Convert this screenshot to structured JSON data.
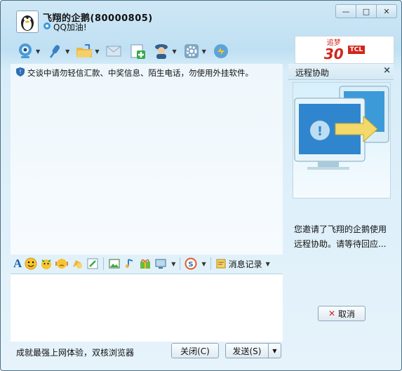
{
  "title": {
    "name": "飞翔的企鹅(80000805)",
    "status": "QQ加油!"
  },
  "window_buttons": {
    "minimize": "—",
    "maximize": "□",
    "close": "✕"
  },
  "ad": {
    "top": "追梦",
    "big": "30",
    "brand": "TCL"
  },
  "notice": "交谈中请勿轻信汇款、中奖信息、陌生电话，勿使用外挂软件。",
  "format_bar": {
    "history_label": "消息记录"
  },
  "bottom": {
    "slogan": "成就最强上网体验，双核浏览器",
    "close_label": "关闭(C)",
    "send_label": "发送(S)"
  },
  "side": {
    "title": "远程协助",
    "message": "您邀请了飞翔的企鹅使用远程协助。请等待回应...",
    "cancel_label": "取消"
  },
  "colors": {
    "accent": "#3a88c6",
    "panel": "#e6f3fb"
  }
}
